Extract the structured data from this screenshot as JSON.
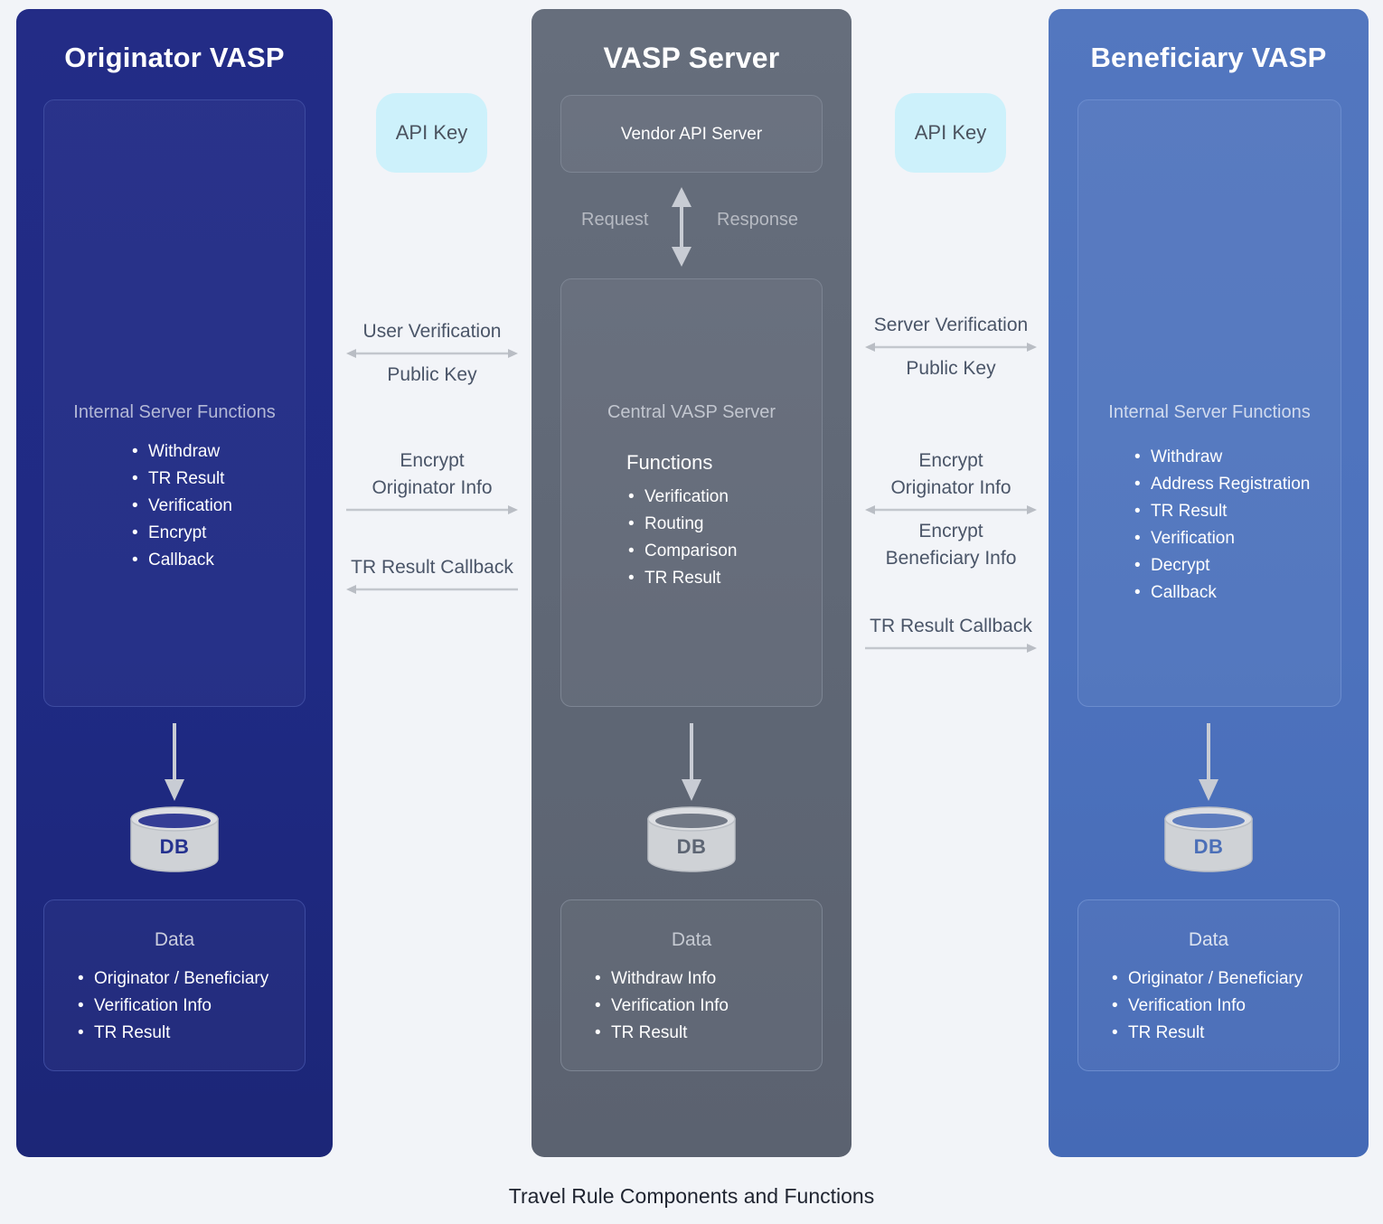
{
  "caption": "Travel Rule Components and Functions",
  "columns": {
    "originator": {
      "title": "Originator VASP",
      "panel_heading": "Internal Server Functions",
      "functions": [
        "Withdraw",
        "TR Result",
        "Verification",
        "Encrypt",
        "Callback"
      ],
      "db_label": "DB",
      "data_title": "Data",
      "data_items": [
        "Originator / Beneficiary",
        "Verification Info",
        "TR Result"
      ],
      "color": "#232c86"
    },
    "vasp": {
      "title": "VASP Server",
      "vendor_label": "Vendor API Server",
      "request_label": "Request",
      "response_label": "Response",
      "panel_heading": "Central VASP Server",
      "functions_heading": "Functions",
      "functions": [
        "Verification",
        "Routing",
        "Comparison",
        "TR Result"
      ],
      "db_label": "DB",
      "data_title": "Data",
      "data_items": [
        "Withdraw Info",
        "Verification Info",
        "TR Result"
      ],
      "color": "#666e7c"
    },
    "beneficiary": {
      "title": "Beneficiary  VASP",
      "panel_heading": "Internal Server Functions",
      "functions": [
        "Withdraw",
        "Address Registration",
        "TR Result",
        "Verification",
        "Decrypt",
        "Callback"
      ],
      "db_label": "DB",
      "data_title": "Data",
      "data_items": [
        "Originator / Beneficiary",
        "Verification Info",
        "TR Result"
      ],
      "color": "#5377bf"
    }
  },
  "api_keys": {
    "left_label": "API Key",
    "right_label": "API Key",
    "badge_color": "#cdf1fb"
  },
  "connectors_left": {
    "group1_top": "User Verification",
    "group1_bottom": "Public Key",
    "group2_line1": "Encrypt",
    "group2_line2": "Originator Info",
    "group3_label": "TR Result Callback"
  },
  "connectors_right": {
    "group1_top": "Server Verification",
    "group1_bottom": "Public Key",
    "group2_line1": "Encrypt",
    "group2_line2": "Originator Info",
    "group2_line3": "Encrypt",
    "group2_line4": "Beneficiary Info",
    "group3_label": "TR Result Callback"
  },
  "icons": {
    "db_cylinder": "database-cylinder-icon",
    "arrow_down": "arrow-down-icon",
    "arrow_double": "double-arrow-icon",
    "arrow_right": "arrow-right-icon",
    "arrow_left": "arrow-left-icon",
    "arrow_vertical_double": "vertical-double-arrow-icon"
  }
}
